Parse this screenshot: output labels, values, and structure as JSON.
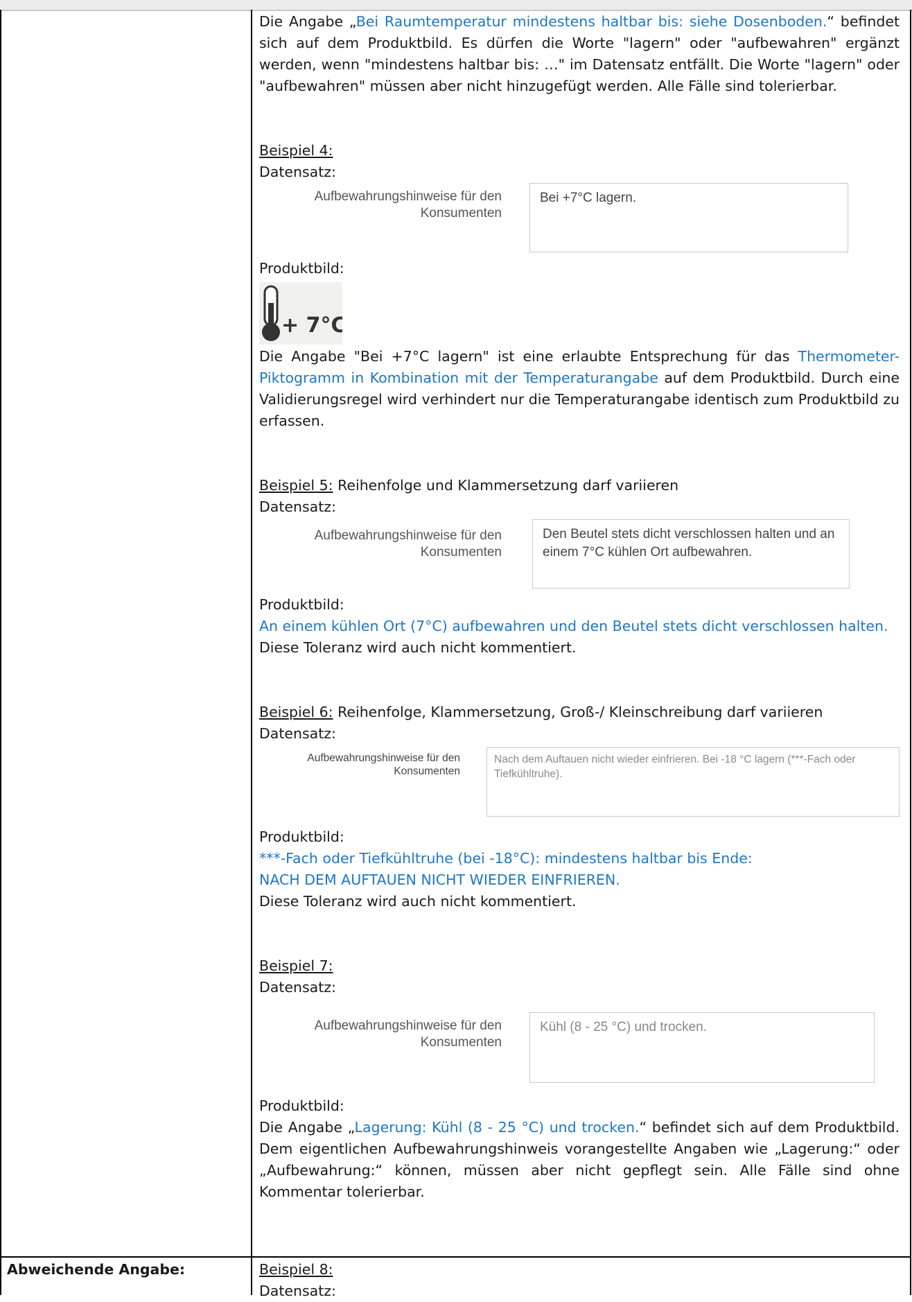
{
  "p1": {
    "a": "Die Angabe „",
    "b": "Bei Raumtemperatur mindestens haltbar bis: siehe Dosenboden.",
    "c": "“ befindet sich auf dem Produktbild. Es dürfen die Worte \"lagern\" oder \"aufbewahren\" ergänzt werden, wenn \"mindestens haltbar bis: …\" im Datensatz entfällt. Die Worte \"lagern\" oder \"aufbewahren\" müssen aber nicht hinzugefügt werden. Alle Fälle sind tolerierbar."
  },
  "labels": {
    "datensatz": "Datensatz:",
    "produktbild": "Produktbild:",
    "field_label": "Aufbewahrungshinweise für den Konsumenten"
  },
  "ex4": {
    "title": "Beispiel 4:",
    "box": "Bei +7°C lagern.",
    "image_text": "+ 7°C",
    "text_a": "Die Angabe \"Bei +7°C lagern\" ist eine erlaubte Entsprechung für das ",
    "text_b": "Thermometer-Piktogramm in Kombination mit der Temperaturangabe",
    "text_c": " auf dem Produktbild. Durch eine Validierungsregel wird verhindert nur die Temperaturangabe identisch zum Produktbild zu erfassen."
  },
  "ex5": {
    "title": "Beispiel 5:",
    "subtitle": " Reihenfolge und Klammersetzung darf variieren",
    "box": "Den Beutel stets dicht verschlossen halten und an einem 7°C kühlen Ort aufbewahren.",
    "image_text": "An einem kühlen Ort (7°C) aufbewahren und den Beutel stets dicht verschlossen halten.",
    "note": "Diese Toleranz wird auch nicht kommentiert."
  },
  "ex6": {
    "title": "Beispiel 6:",
    "subtitle": " Reihenfolge, Klammersetzung, Groß-/ Kleinschreibung darf variieren",
    "box": "Nach dem Auftauen nicht wieder einfrieren. Bei -18 °C lagern (***-Fach oder Tiefkühltruhe).",
    "image_line1": "***-Fach oder Tiefkühltruhe (bei -18°C): mindestens haltbar bis Ende:",
    "image_line2": "NACH DEM AUFTAUEN NICHT WIEDER EINFRIEREN.",
    "note": "Diese Toleranz wird auch nicht kommentiert."
  },
  "ex7": {
    "title": "Beispiel 7:",
    "box": "Kühl (8 - 25 °C) und trocken.",
    "text_a": "Die Angabe „",
    "text_b": "Lagerung: Kühl (8 - 25 °C) und trocken.",
    "text_c": "“ befindet sich auf dem Produktbild. Dem eigentlichen Aufbewahrungshinweis vorangestellte Angaben wie „Lagerung:“ oder „Aufbewahrung:“ können, müssen aber nicht gepflegt sein. Alle Fälle sind ohne Kommentar tolerierbar."
  },
  "row2": {
    "label": "Abweichende Angabe:",
    "title": "Beispiel 8:"
  }
}
